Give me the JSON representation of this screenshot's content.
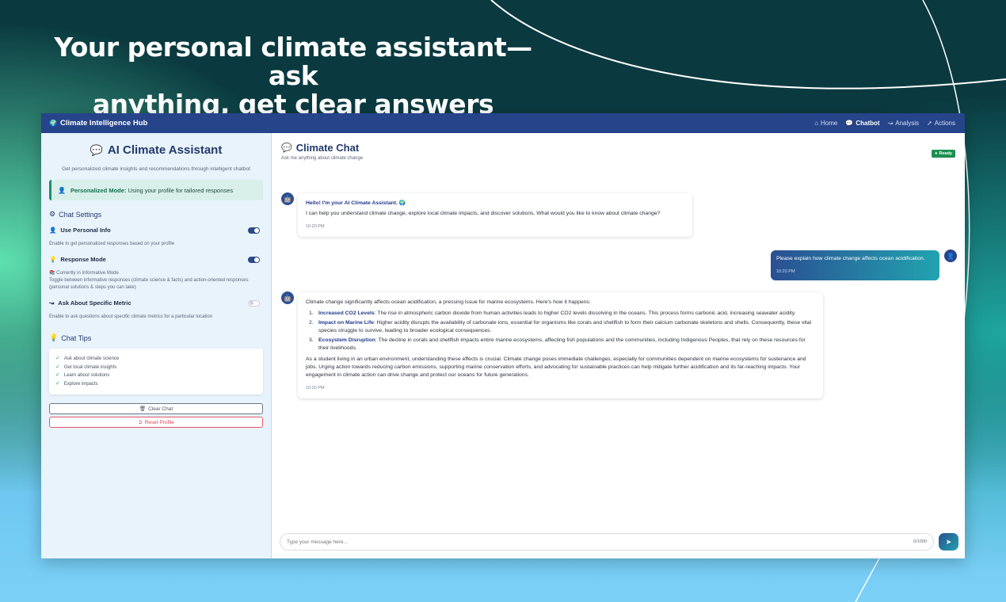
{
  "hero": {
    "line1": "Your personal climate assistant—ask",
    "line2": "anything, get clear answers"
  },
  "topbar": {
    "brand": "Climate Intelligence Hub",
    "nav": [
      {
        "label": "Home",
        "icon": "home-icon",
        "active": false
      },
      {
        "label": "Chatbot",
        "icon": "chat-icon",
        "active": true
      },
      {
        "label": "Analysis",
        "icon": "chart-icon",
        "active": false
      },
      {
        "label": "Actions",
        "icon": "rocket-icon",
        "active": false
      }
    ]
  },
  "sidebar": {
    "title": "AI Climate Assistant",
    "subtitle": "Get personalized climate insights and recommendations through intelligent chatbot",
    "mode_label": "Personalized Mode:",
    "mode_text": "Using your profile for tailored responses",
    "settings_heading": "Chat Settings",
    "settings": {
      "personal": {
        "label": "Use Personal Info",
        "desc": "Enable to get personalized responses based on your profile",
        "on": true
      },
      "response": {
        "label": "Response Mode",
        "current": "Currently in Informative Mode",
        "desc": "Toggle between informative responses (climate science & facts) and action-oriented responses (personal solutions & steps you can take)",
        "on": true
      },
      "metric": {
        "label": "Ask About Specific Metric",
        "desc": "Enable to ask questions about specific climate metrics for a particular location",
        "on": false
      }
    },
    "tips_heading": "Chat Tips",
    "tips": [
      "Ask about climate science",
      "Get local climate insights",
      "Learn about solutions",
      "Explore impacts"
    ],
    "clear_label": "Clear Chat",
    "reset_label": "Reset Profile"
  },
  "chat": {
    "title": "Climate Chat",
    "subtitle": "Ask me anything about climate change",
    "status": "Ready",
    "msg1": {
      "greeting": "Hello! I'm your AI Climate Assistant. 🌍",
      "text": "I can help you understand climate change, explore local climate impacts, and discover solutions. What would you like to know about climate change?",
      "time": "10:20 PM"
    },
    "user_msg": {
      "text": "Please explain how climate change affects ocean acidification.",
      "time": "10:20 PM"
    },
    "msg2": {
      "intro": "Climate change significantly affects ocean acidification, a pressing issue for marine ecosystems. Here's how it happens:",
      "points": [
        {
          "num": "1.",
          "title": "Increased CO2 Levels",
          "text": ": The rise in atmospheric carbon dioxide from human activities leads to higher CO2 levels dissolving in the oceans. This process forms carbonic acid, increasing seawater acidity."
        },
        {
          "num": "2.",
          "title": "Impact on Marine Life",
          "text": ": Higher acidity disrupts the availability of carbonate ions, essential for organisms like corals and shellfish to form their calcium carbonate skeletons and shells. Consequently, these vital species struggle to survive, leading to broader ecological consequences."
        },
        {
          "num": "3.",
          "title": "Ecosystem Disruption",
          "text": ": The decline in corals and shellfish impacts entire marine ecosystems, affecting fish populations and the communities, including Indigenous Peoples, that rely on these resources for their livelihoods."
        }
      ],
      "outro": "As a student living in an urban environment, understanding these effects is crucial. Climate change poses immediate challenges, especially for communities dependent on marine ecosystems for sustenance and jobs. Urging action towards reducing carbon emissions, supporting marine conservation efforts, and advocating for sustainable practices can help mitigate further acidification and its far-reaching impacts. Your engagement in climate action can drive change and protect our oceans for future generations.",
      "time": "10:20 PM"
    },
    "input_placeholder": "Type your message here...",
    "counter": "0/1000"
  }
}
